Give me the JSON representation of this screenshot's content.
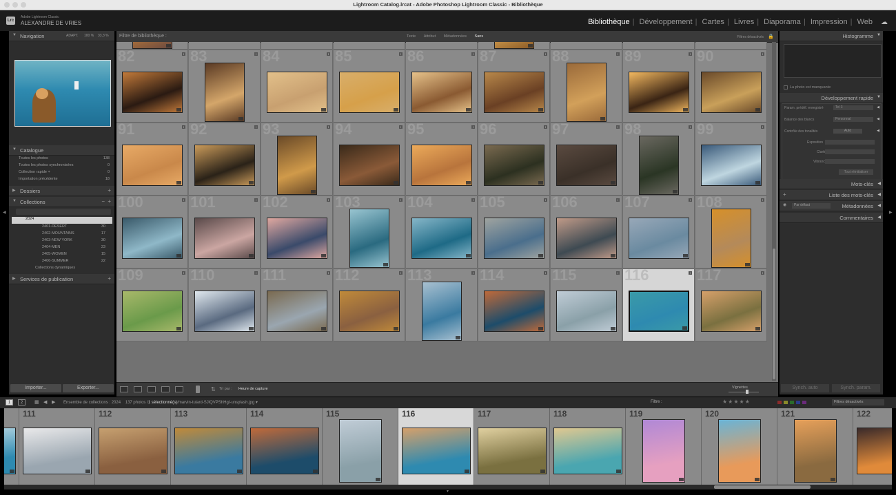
{
  "window": {
    "title": "Lightroom Catalog.lrcat - Adobe Photoshop Lightroom Classic - Bibliothèque"
  },
  "identity": {
    "product": "Adobe Lightroom Classic",
    "name": "ALEXANDRE DE VRIES",
    "logo": "Lrc"
  },
  "modules": [
    {
      "label": "Bibliothèque",
      "active": true
    },
    {
      "label": "Développement",
      "active": false
    },
    {
      "label": "Cartes",
      "active": false
    },
    {
      "label": "Livres",
      "active": false
    },
    {
      "label": "Diaporama",
      "active": false
    },
    {
      "label": "Impression",
      "active": false
    },
    {
      "label": "Web",
      "active": false
    }
  ],
  "left_panel": {
    "navigator": {
      "label": "Navigation",
      "zoom_options": [
        "ADAPT.",
        "100 %",
        "33,3 %"
      ]
    },
    "catalog": {
      "label": "Catalogue",
      "items": [
        {
          "label": "Toutes les photos",
          "count": "138"
        },
        {
          "label": "Toutes les photos synchronisées",
          "count": "0"
        },
        {
          "label": "Collection rapide +",
          "count": "0"
        },
        {
          "label": "Importation précédente",
          "count": "18"
        }
      ]
    },
    "folders": {
      "label": "Dossiers"
    },
    "collections": {
      "label": "Collections",
      "set": "2024",
      "items": [
        {
          "label": "2401-DESERT",
          "count": "30"
        },
        {
          "label": "2402-MOUNTAINS",
          "count": "17"
        },
        {
          "label": "2403-NEW YORK",
          "count": "30"
        },
        {
          "label": "2404-MEN",
          "count": "23"
        },
        {
          "label": "2405-WOMEN",
          "count": "15"
        },
        {
          "label": "2406-SUMMER",
          "count": "22"
        },
        {
          "label": "Collections dynamiques",
          "count": ""
        }
      ]
    },
    "publish": {
      "label": "Services de publication"
    },
    "import_label": "Importer...",
    "export_label": "Exporter..."
  },
  "filter_bar": {
    "label": "Filtre de bibliothèque :",
    "options": [
      "Texte",
      "Attribut",
      "Métadonnées",
      "Sans"
    ],
    "selected": "Sans",
    "status": "Filtres désactivés"
  },
  "grid": {
    "cols": 9,
    "rows": [
      {
        "start": null,
        "partial": true
      },
      {
        "start": 82
      },
      {
        "start": 91
      },
      {
        "start": 100
      },
      {
        "start": 109
      }
    ],
    "selected": 116,
    "palette": [
      [
        "#b97838",
        "#c88a3a",
        "#d2a660",
        "#c4963e",
        "#b5803a",
        "#d9a352",
        "#d6b274",
        "#d29a3c",
        "#b88a4c"
      ],
      [
        "#2a1a12",
        "#d4a66a",
        "#c8a070",
        "#d6a04a",
        "#8a5a32",
        "#6a4024",
        "#d2a05a",
        "#3a2414",
        "#c9a05a"
      ],
      [
        "#c9884a",
        "#2a2218",
        "#d09a4a",
        "#8a5a38",
        "#b8743c",
        "#2c3020",
        "#3a3028",
        "#2a3524",
        "#bfd6e0"
      ],
      [
        "#8fb8c8",
        "#cba6a2",
        "#3a4a6a",
        "#2a6a80",
        "#1e6a86",
        "#4a6e8c",
        "#3e4a52",
        "#6a8aa0",
        "#b48a5a"
      ],
      [
        "#6a9a4a",
        "#5a6a80",
        "#9aa6b0",
        "#8a6040",
        "#3a7aa0",
        "#1d4c6a",
        "#8aa0a8",
        "#2e8ab0",
        "#7a7040"
      ]
    ],
    "palette2": [
      [
        "#6a4a40",
        "#e3a36a",
        "#7a5a32",
        "#d6b28a",
        "#9a7a4a",
        "#8a5a26",
        "#7a5a3a",
        "#e8c07a",
        "#6a4a2a"
      ],
      [
        "#c27a3a",
        "#5a3a24",
        "#e2c08a",
        "#d8ae6a",
        "#e6c28a",
        "#b8884a",
        "#9a6a3a",
        "#f2b860",
        "#6a4a2a"
      ],
      [
        "#e8aa66",
        "#c99a5a",
        "#6a4a28",
        "#3a2a1a",
        "#ecaa5a",
        "#7a6a50",
        "#5a4a40",
        "#6a6860",
        "#3a5a7a"
      ],
      [
        "#3a5a6a",
        "#5a4a4a",
        "#e0a8a0",
        "#98c4d0",
        "#86b6c8",
        "#a0a4a0",
        "#c09a88",
        "#98a8b8",
        "#d6902a"
      ],
      [
        "#a8b86a",
        "#e0e8ee",
        "#7a6a50",
        "#c08a3a",
        "#a8c0d0",
        "#c06a3a",
        "#c0ccd6",
        "#3a9aa8",
        "#d6a06a"
      ]
    ]
  },
  "toolbar": {
    "sort_label": "Tri par :",
    "sort_value": "Heure de capture",
    "thumbnails_label": "Vignettes"
  },
  "filmstrip_bar": {
    "pages": [
      "1",
      "2"
    ],
    "source": "Ensemble de collections : 2024",
    "count_text": "137 photos /",
    "selected_text": "1 sélectionné(s)",
    "filename": "/marvin-tulard-SJlQVPShHgI-unsplash.jpg",
    "filter_label": "Filtre :",
    "stars": "★★★★★",
    "filter_status": "Filtres désactivés"
  },
  "filmstrip": {
    "items": [
      {
        "num": "",
        "colors": [
          "#2e8ab0",
          "#cde2ea"
        ]
      },
      {
        "num": "111",
        "colors": [
          "#9aa6b0",
          "#e9e9ea"
        ]
      },
      {
        "num": "112",
        "colors": [
          "#8a6040",
          "#c6a070"
        ]
      },
      {
        "num": "113",
        "colors": [
          "#3a7aa0",
          "#c08a3a"
        ]
      },
      {
        "num": "114",
        "colors": [
          "#1d4c6a",
          "#c06a3a"
        ]
      },
      {
        "num": "115",
        "colors": [
          "#8aa0a8",
          "#c0ccd6"
        ]
      },
      {
        "num": "116",
        "colors": [
          "#2e8ab0",
          "#d6a06a"
        ]
      },
      {
        "num": "117",
        "colors": [
          "#7a7040",
          "#e0d0a0"
        ]
      },
      {
        "num": "118",
        "colors": [
          "#4aa6b0",
          "#e0c890"
        ]
      },
      {
        "num": "119",
        "colors": [
          "#e6a0c0",
          "#b088d6"
        ]
      },
      {
        "num": "120",
        "colors": [
          "#e89a5a",
          "#6ab4d6"
        ]
      },
      {
        "num": "121",
        "colors": [
          "#8a6a40",
          "#e6a05a"
        ]
      },
      {
        "num": "122",
        "colors": [
          "#e08a3a",
          "#3a2a2a"
        ]
      }
    ],
    "selected": "116"
  },
  "right_panel": {
    "histogram": {
      "label": "Histogramme",
      "missing_text": "La photo est manquante"
    },
    "quick_develop": {
      "label": "Développement rapide",
      "rows": [
        {
          "label": "Param. prédéf. enregistré",
          "value": "Tel 3"
        },
        {
          "label": "Balance des blancs",
          "value": "Personnal"
        },
        {
          "label": "Contrôle des tonalités",
          "value": "Auto"
        }
      ],
      "sliders": [
        "Exposition",
        "Clarté",
        "Vibrance"
      ],
      "reset_label": "Tout réinitialiser"
    },
    "keywording": {
      "label": "Mots-clés"
    },
    "keyword_list": {
      "label": "Liste des mots-clés"
    },
    "metadata": {
      "label": "Métadonnées",
      "preset": "Par défaut"
    },
    "comments": {
      "label": "Commentaires"
    },
    "sync_label": "Synch. auto",
    "sync_settings_label": "Synch. param."
  }
}
